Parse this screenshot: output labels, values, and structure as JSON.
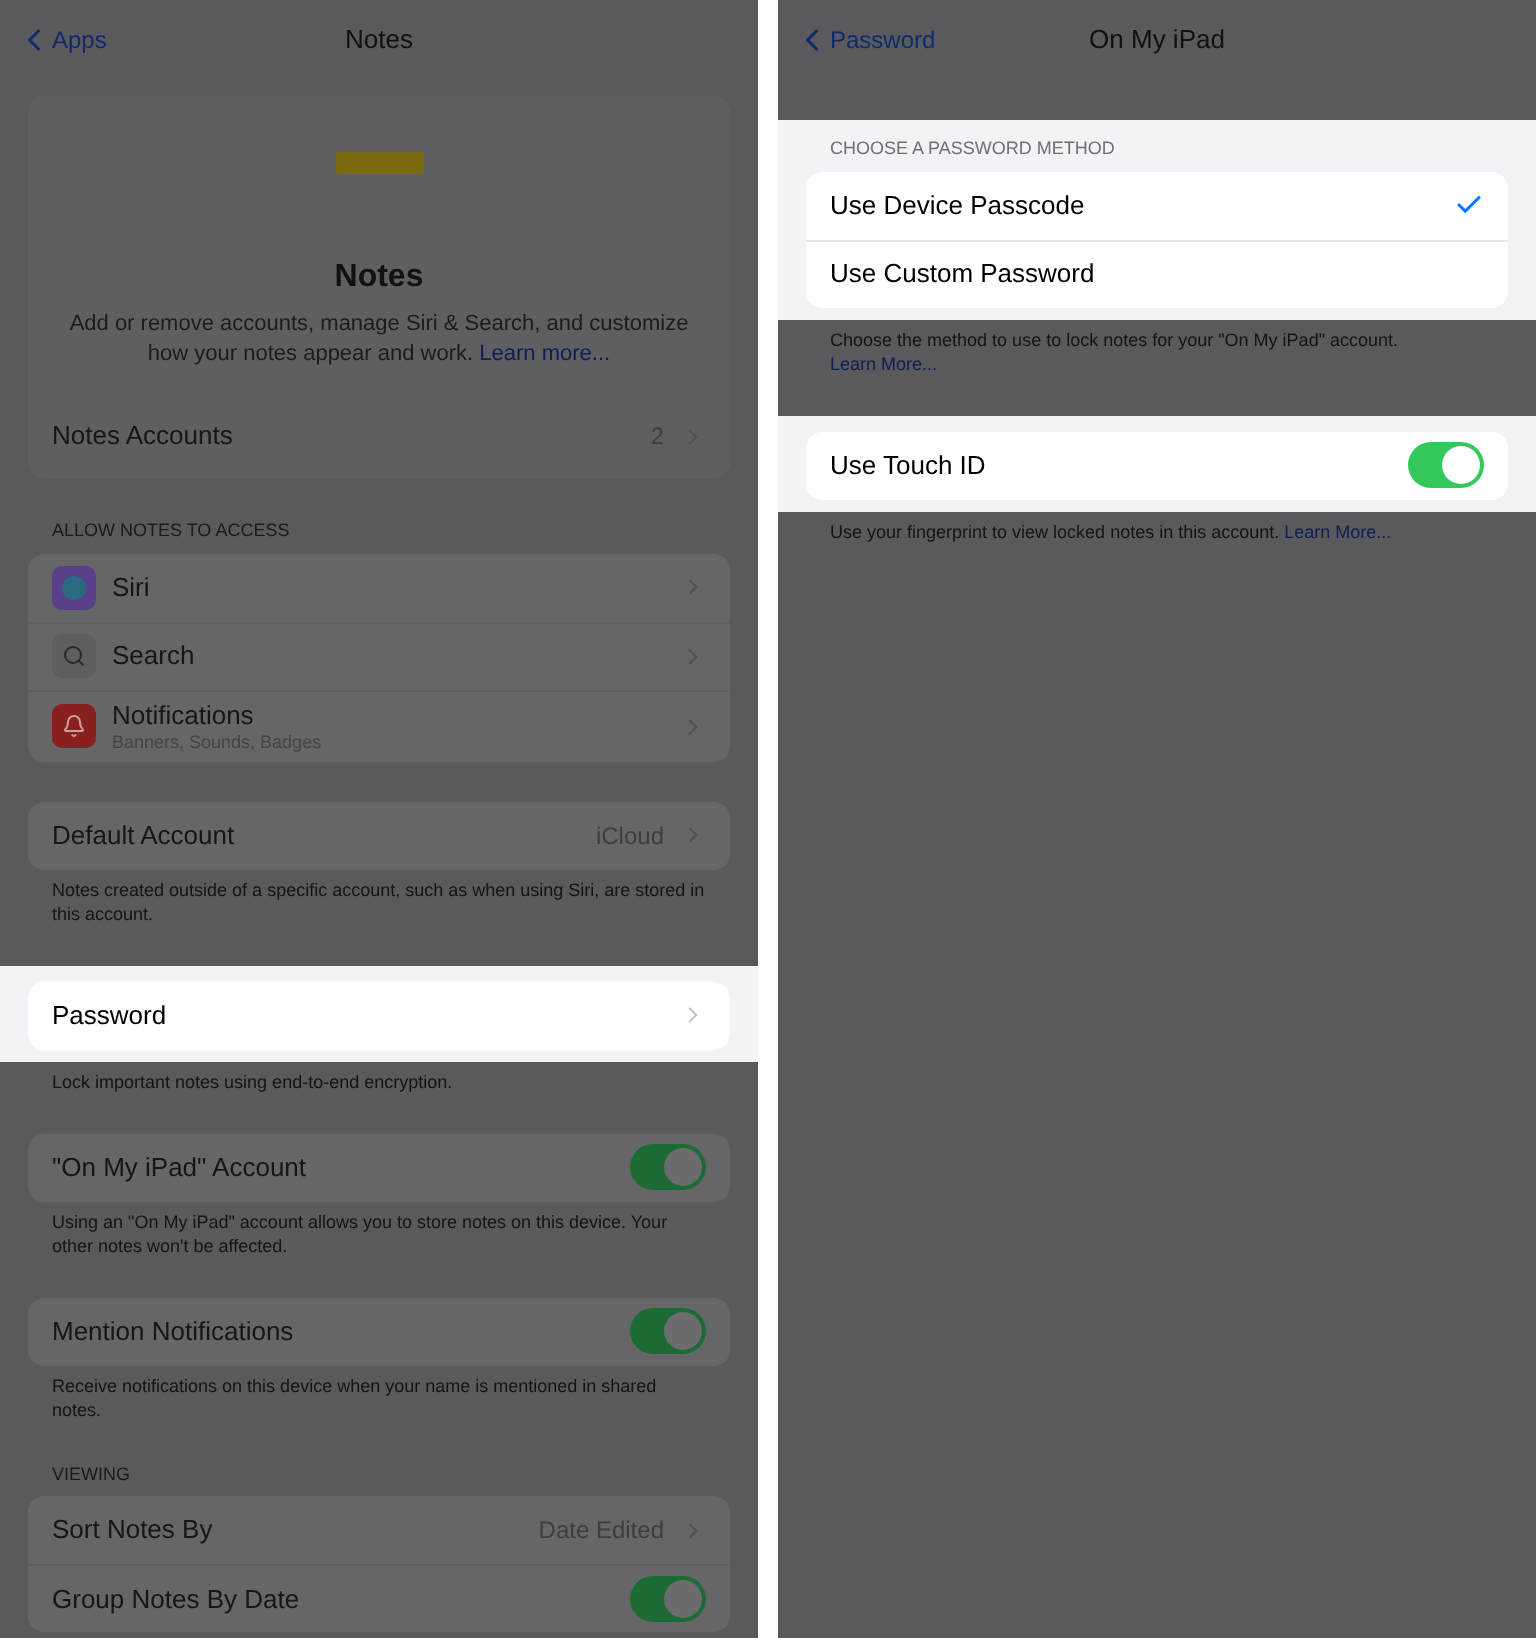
{
  "panels": [
    {
      "nav": {
        "back": "Apps",
        "title": "Notes"
      },
      "header": {
        "title": "Notes",
        "description": "Add or remove accounts, manage Siri & Search, and customize how your notes appear and work.",
        "link": "Learn more..."
      },
      "header_rows": [
        {
          "kind": "nav",
          "label": "Notes Accounts",
          "value": "2"
        }
      ],
      "sections": [
        {
          "header": "ALLOW NOTES TO ACCESS",
          "highlighted": false,
          "rows": [
            {
              "kind": "nav",
              "label": "Siri",
              "color": "#5a3f8a"
            },
            {
              "kind": "nav",
              "label": "Search",
              "color": "#5e5e62"
            },
            {
              "kind": "nav",
              "label": "Notifications",
              "subtitle": "Banners, Sounds, Badges",
              "color": "#8a1f1f"
            }
          ]
        },
        {
          "highlighted": false,
          "rows": [
            {
              "kind": "nav",
              "label": "Default Account",
              "value": "iCloud"
            }
          ],
          "footer": "Notes created outside of a specific account, such as when using Siri, are stored in this account."
        },
        {
          "highlighted": true,
          "rows": [
            {
              "kind": "nav",
              "label": "Password"
            }
          ],
          "footer": "Lock important notes using end-to-end encryption."
        },
        {
          "highlighted": false,
          "rows": [
            {
              "kind": "toggle",
              "label": "\"On My iPad\" Account",
              "on": true
            }
          ],
          "footer": "Using an \"On My iPad\" account allows you to store notes on this device. Your other notes won't be affected."
        },
        {
          "highlighted": false,
          "rows": [
            {
              "kind": "toggle",
              "label": "Mention Notifications",
              "on": true
            }
          ],
          "footer": "Receive notifications on this device when your name is mentioned in shared notes."
        },
        {
          "header": "VIEWING",
          "highlighted": false,
          "rows": [
            {
              "kind": "nav",
              "label": "Sort Notes By",
              "value": "Date Edited"
            },
            {
              "kind": "toggle",
              "label": "Group Notes By Date",
              "on": true
            }
          ]
        }
      ]
    },
    {
      "nav": {
        "back": "Password",
        "title": "On My iPad"
      },
      "sections": [
        {
          "header": "CHOOSE A PASSWORD METHOD",
          "highlighted": true,
          "rows": [
            {
              "kind": "check",
              "label": "Use Device Passcode",
              "checked": true
            },
            {
              "kind": "check",
              "label": "Use Custom Password",
              "checked": false
            }
          ],
          "footer": "Choose the method to use to lock notes for your \"On My iPad\" account.",
          "footer_link": "Learn More..."
        },
        {
          "highlighted": true,
          "rows": [
            {
              "kind": "toggle",
              "label": "Use Touch ID",
              "on": true
            }
          ],
          "footer": "Use your fingerprint to view locked notes in this account.",
          "footer_link": "Learn More..."
        }
      ]
    }
  ]
}
